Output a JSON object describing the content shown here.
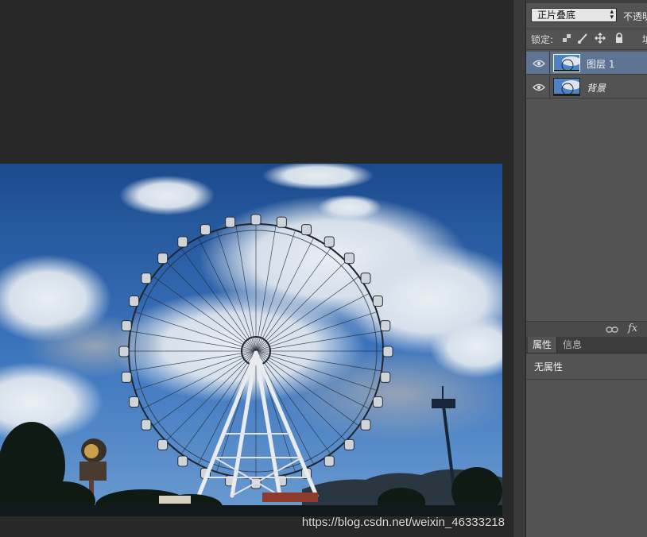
{
  "layers_panel": {
    "blend_mode": "正片叠底",
    "opacity_label": "不透明",
    "lock_label": "锁定:",
    "fill_clip": "填",
    "lock_icons": [
      "lock-transparent-icon",
      "lock-paint-icon",
      "lock-position-icon",
      "lock-all-icon"
    ],
    "layers": [
      {
        "name": "图层 1",
        "selected": true,
        "visible": true
      },
      {
        "name": "背景",
        "selected": false,
        "visible": true
      }
    ],
    "footer_icons": [
      "link-layers-icon",
      "fx-icon"
    ],
    "fx_label": "fx"
  },
  "properties_panel": {
    "tabs": [
      "属性",
      "信息"
    ],
    "active_tab": "属性",
    "message": "无属性"
  },
  "watermark": "https://blog.csdn.net/weixin_46333218",
  "colors": {
    "app_bg": "#282828",
    "panel_bg": "#535353",
    "selected_layer": "#5d7493",
    "sky_top": "#1d4f93",
    "sky_bottom": "#5f93cf"
  }
}
